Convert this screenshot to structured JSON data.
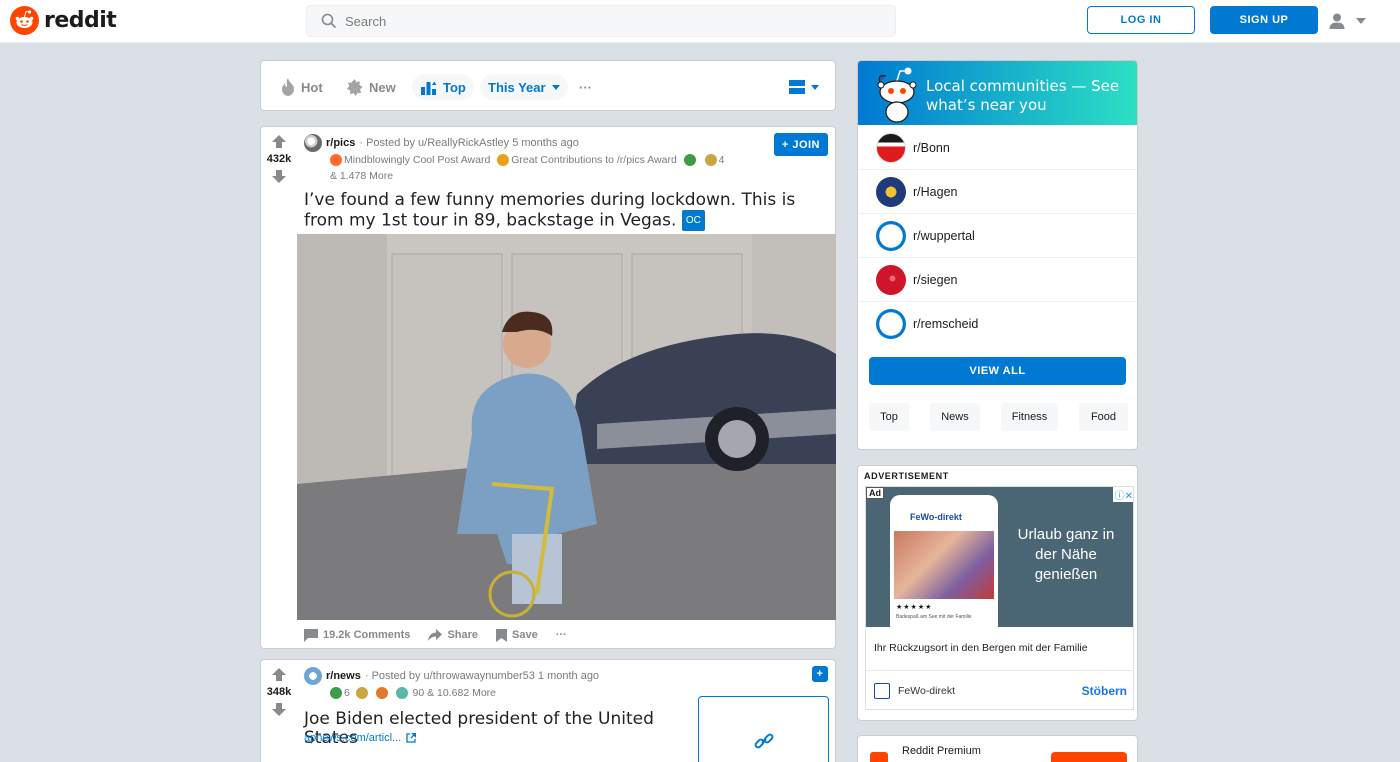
{
  "header": {
    "logo_text": "reddit",
    "search_placeholder": "Search",
    "login_label": "LOG IN",
    "signup_label": "SIGN UP"
  },
  "sortbar": {
    "items": [
      {
        "label": "Hot",
        "icon": "flame-icon"
      },
      {
        "label": "New",
        "icon": "burst-icon"
      },
      {
        "label": "Top",
        "icon": "top-chart-icon",
        "active": true
      }
    ],
    "timeframe": "This Year",
    "more": "···"
  },
  "posts": [
    {
      "votes": "432k",
      "subreddit": "r/pics",
      "posted_by": "· Posted by u/ReallyRickAstley 5 months ago",
      "join_label": "+ JOIN",
      "award_1": "Mindblowingly Cool Post Award",
      "award_2": "Great Contributions to /r/pics Award",
      "award_count": "4",
      "award_more": "& 1.478 More",
      "title": "I’ve found a few funny memories during lockdown. This is from my 1st tour in 89, backstage in Vegas.",
      "flair": "OC",
      "comments": "19.2k Comments",
      "share": "Share",
      "save": "Save",
      "more": "···"
    },
    {
      "votes": "348k",
      "subreddit": "r/news",
      "posted_by": "· Posted by u/throwawaynumber53 1 month ago",
      "join_label": "+",
      "award_count_a": "6",
      "award_more": "90 & 10.682 More",
      "title": "Joe Biden elected president of the United States",
      "link": "apnews.com/articl..."
    }
  ],
  "sidebar": {
    "local_title": "Local communities — See what’s near you",
    "communities": [
      "r/Bonn",
      "r/Hagen",
      "r/wuppertal",
      "r/siegen",
      "r/remscheid"
    ],
    "view_all": "VIEW ALL",
    "tags": [
      "Top",
      "News",
      "Fitness",
      "Food"
    ],
    "ad": {
      "label": "ADVERTISEMENT",
      "badge": "Ad",
      "banner_text": "Urlaub ganz in der Nähe genießen",
      "phone_brand": "FeWo-direkt",
      "phone_caption": "Badespaß am See mit der Familie",
      "tagline": "Ihr Rückzugsort in den Bergen mit der Familie",
      "brand": "FeWo-direkt",
      "cta": "Stöbern"
    },
    "premium_title": "Reddit Premium"
  },
  "colors": {
    "brand": "#ff4500",
    "accent": "#0079d3",
    "background": "#dae0e6"
  }
}
